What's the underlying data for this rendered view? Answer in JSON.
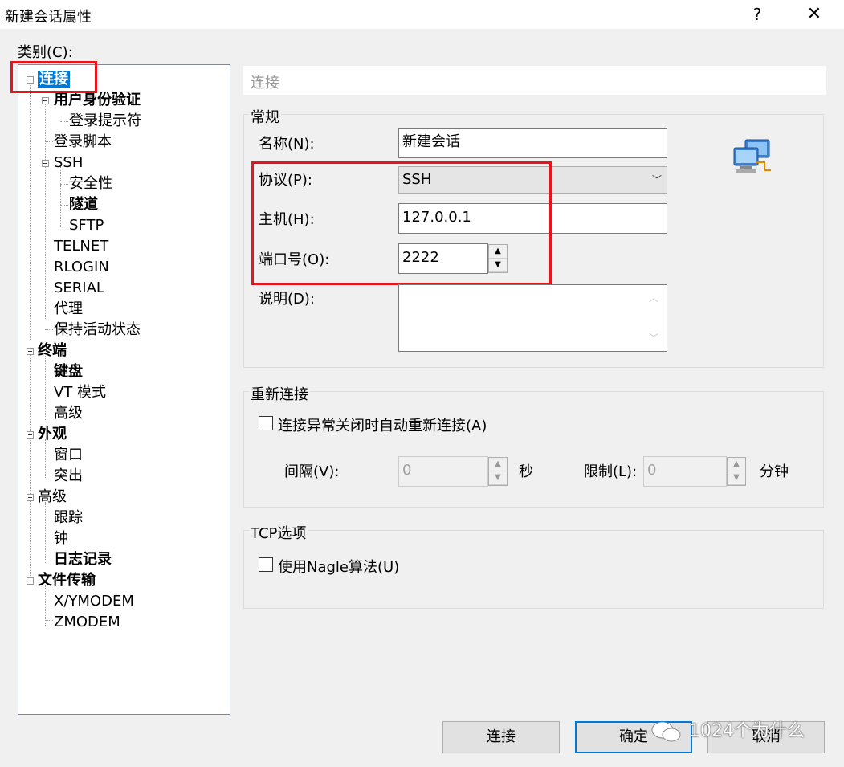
{
  "window": {
    "title": "新建会话属性",
    "help": "?",
    "close": "✕"
  },
  "category_label": "类别(C):",
  "tree": [
    {
      "label": "连接",
      "bold": true,
      "expander": true,
      "selected": true
    },
    {
      "label": "用户身份验证",
      "bold": true,
      "expander": true
    },
    {
      "label": "登录提示符"
    },
    {
      "label": "登录脚本"
    },
    {
      "label": "SSH",
      "expander": true
    },
    {
      "label": "安全性"
    },
    {
      "label": "隧道",
      "bold": true
    },
    {
      "label": "SFTP"
    },
    {
      "label": "TELNET"
    },
    {
      "label": "RLOGIN"
    },
    {
      "label": "SERIAL"
    },
    {
      "label": "代理"
    },
    {
      "label": "保持活动状态"
    },
    {
      "label": "终端",
      "bold": true,
      "expander": true
    },
    {
      "label": "键盘",
      "bold": true
    },
    {
      "label": "VT 模式"
    },
    {
      "label": "高级"
    },
    {
      "label": "外观",
      "bold": true,
      "expander": true
    },
    {
      "label": "窗口"
    },
    {
      "label": "突出"
    },
    {
      "label": "高级",
      "expander": true
    },
    {
      "label": "跟踪"
    },
    {
      "label": "钟"
    },
    {
      "label": "日志记录",
      "bold": true
    },
    {
      "label": "文件传输",
      "bold": true,
      "expander": true
    },
    {
      "label": "X/YMODEM"
    },
    {
      "label": "ZMODEM"
    }
  ],
  "section_title": "连接",
  "general": {
    "title": "常规",
    "name_label": "名称(N):",
    "name_value": "新建会话",
    "protocol_label": "协议(P):",
    "protocol_value": "SSH",
    "host_label": "主机(H):",
    "host_value": "127.0.0.1",
    "port_label": "端口号(O):",
    "port_value": "2222",
    "desc_label": "说明(D):",
    "desc_value": ""
  },
  "reconnect": {
    "title": "重新连接",
    "checkbox_label": "连接异常关闭时自动重新连接(A)",
    "checked": false,
    "interval_label": "间隔(V):",
    "interval_value": "0",
    "interval_unit": "秒",
    "limit_label": "限制(L):",
    "limit_value": "0",
    "limit_unit": "分钟"
  },
  "tcp": {
    "title": "TCP选项",
    "nagle_label": "使用Nagle算法(U)",
    "checked": false
  },
  "buttons": {
    "connect": "连接",
    "ok": "确定",
    "cancel": "取消"
  },
  "watermark": "1024个为什么",
  "highlight_color": "#e8141c",
  "selection_color": "#0078d7"
}
